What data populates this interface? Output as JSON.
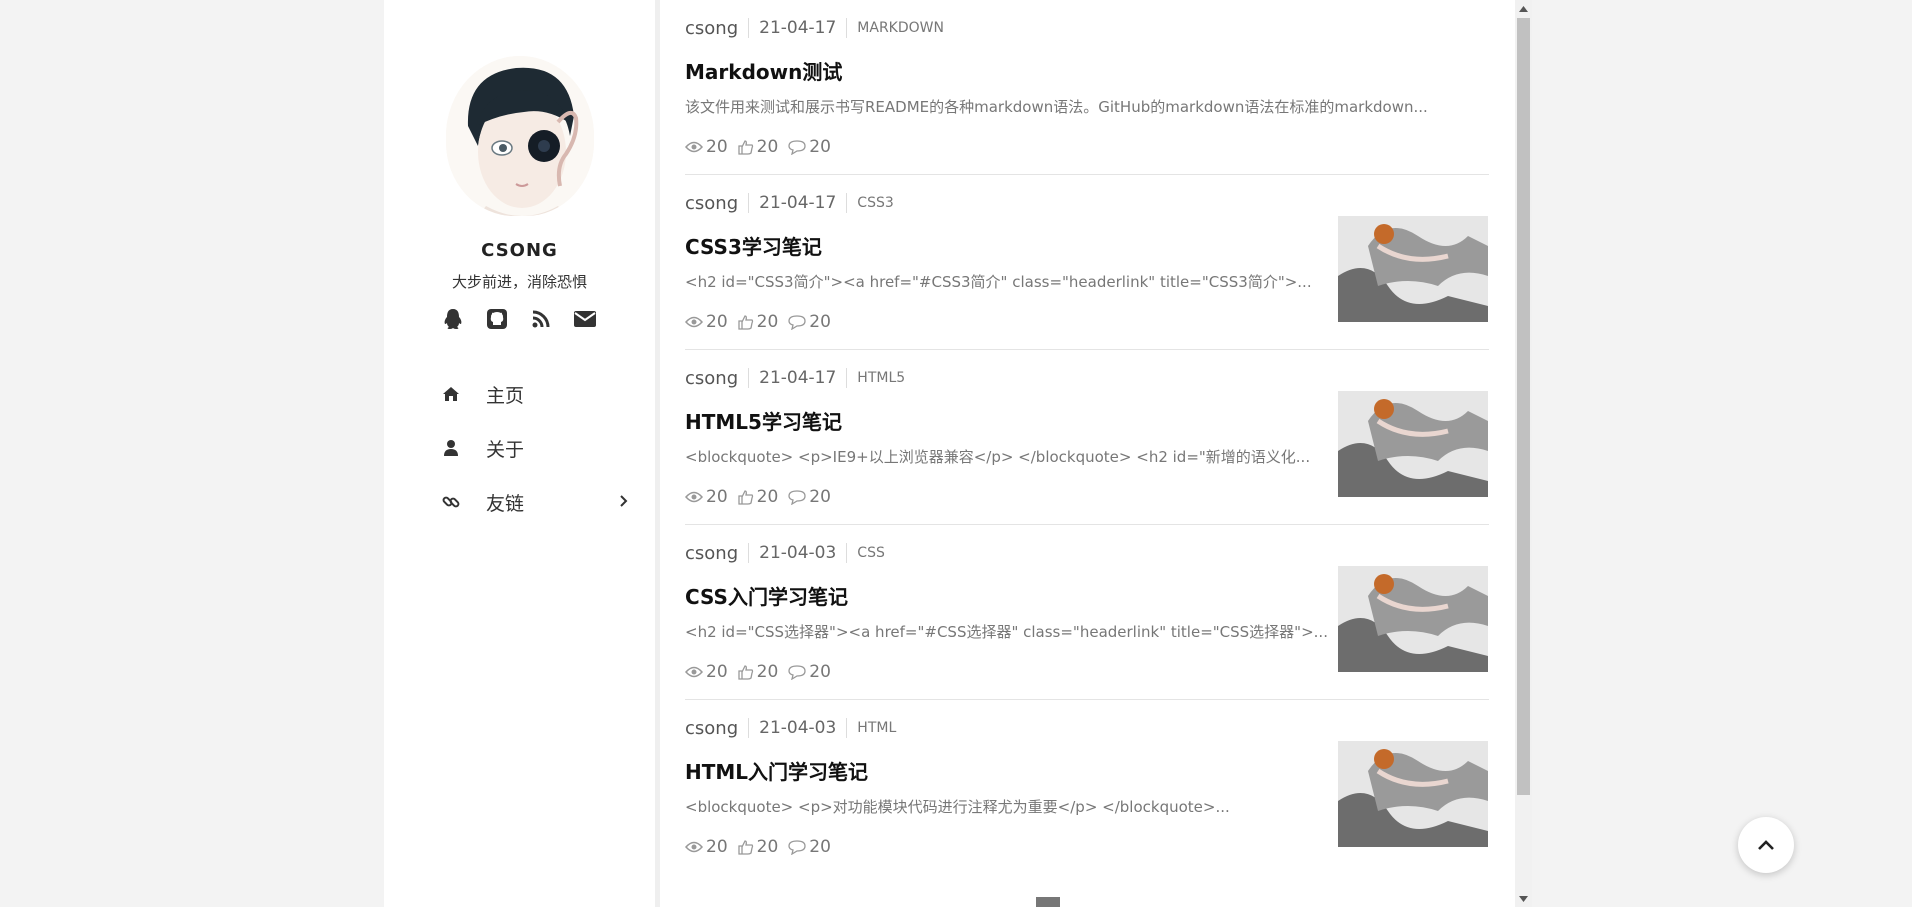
{
  "profile": {
    "name": "CSONG",
    "motto": "大步前进，消除恐惧",
    "socials": [
      "qq-icon",
      "github-icon",
      "rss-icon",
      "email-icon"
    ]
  },
  "nav": [
    {
      "label": "主页",
      "icon": "home-icon"
    },
    {
      "label": "关于",
      "icon": "user-icon"
    },
    {
      "label": "友链",
      "icon": "link-icon",
      "has_submenu": true
    }
  ],
  "posts": [
    {
      "author": "csong",
      "date": "21-04-17",
      "category": "MARKDOWN",
      "title": "Markdown测试",
      "excerpt": "该文件用来测试和展示书写README的各种markdown语法。GitHub的markdown语法在标准的markdown...",
      "views": "20",
      "likes": "20",
      "comments": "20",
      "has_thumb": false
    },
    {
      "author": "csong",
      "date": "21-04-17",
      "category": "CSS3",
      "title": "CSS3学习笔记",
      "excerpt": "<h2 id=\"CSS3简介\"><a href=\"#CSS3简介\" class=\"headerlink\" title=\"CSS3简介\">...",
      "views": "20",
      "likes": "20",
      "comments": "20",
      "has_thumb": true
    },
    {
      "author": "csong",
      "date": "21-04-17",
      "category": "HTML5",
      "title": "HTML5学习笔记",
      "excerpt": "<blockquote> <p>IE9+以上浏览器兼容</p> </blockquote> <h2 id=\"新增的语义化...",
      "views": "20",
      "likes": "20",
      "comments": "20",
      "has_thumb": true
    },
    {
      "author": "csong",
      "date": "21-04-03",
      "category": "CSS",
      "title": "CSS入门学习笔记",
      "excerpt": "<h2 id=\"CSS选择器\"><a href=\"#CSS选择器\" class=\"headerlink\" title=\"CSS选择器\">...",
      "views": "20",
      "likes": "20",
      "comments": "20",
      "has_thumb": true
    },
    {
      "author": "csong",
      "date": "21-04-03",
      "category": "HTML",
      "title": "HTML入门学习笔记",
      "excerpt": "<blockquote> <p>对功能模块代码进行注释尤为重要</p> </blockquote>...",
      "views": "20",
      "likes": "20",
      "comments": "20",
      "has_thumb": true
    }
  ],
  "colors": {
    "text_muted": "#777777",
    "title": "#111111",
    "bg": "#f3f3f3"
  }
}
